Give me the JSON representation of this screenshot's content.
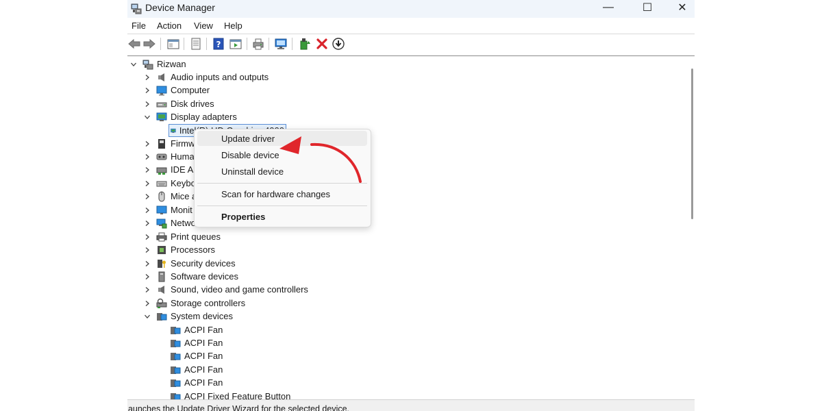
{
  "window": {
    "title": "Device Manager"
  },
  "window_controls": {
    "minimize": "—",
    "maximize": "☐",
    "close": "✕"
  },
  "menu": [
    "File",
    "Action",
    "View",
    "Help"
  ],
  "toolbar_icons": [
    "back-arrow-icon",
    "forward-arrow-icon",
    "show-hide-console-tree-icon",
    "properties-sheet-icon",
    "help-icon",
    "show-action-pane-icon",
    "print-icon",
    "scan-hardware-icon",
    "update-driver-icon",
    "disable-device-icon",
    "uninstall-device-icon",
    "download-driver-icon"
  ],
  "tree": {
    "root": "Rizwan",
    "categories": [
      {
        "label": "Audio inputs and outputs",
        "icon": "speaker-icon",
        "expanded": false
      },
      {
        "label": "Computer",
        "icon": "computer-icon",
        "expanded": false
      },
      {
        "label": "Disk drives",
        "icon": "disk-drive-icon",
        "expanded": false
      },
      {
        "label": "Display adapters",
        "icon": "display-adapter-icon",
        "expanded": true
      },
      {
        "label": "Firmw",
        "icon": "firmware-icon",
        "expanded": false
      },
      {
        "label": "Huma",
        "icon": "hid-icon",
        "expanded": false
      },
      {
        "label": "IDE A",
        "icon": "ide-controller-icon",
        "expanded": false
      },
      {
        "label": "Keybo",
        "icon": "keyboard-icon",
        "expanded": false
      },
      {
        "label": "Mice a",
        "icon": "mouse-icon",
        "expanded": false
      },
      {
        "label": "Monit",
        "icon": "monitor-icon",
        "expanded": false
      },
      {
        "label": "Netwo",
        "icon": "network-adapter-icon",
        "expanded": false
      },
      {
        "label": "Print queues",
        "icon": "printer-icon",
        "expanded": false
      },
      {
        "label": "Processors",
        "icon": "processor-icon",
        "expanded": false
      },
      {
        "label": "Security devices",
        "icon": "security-key-icon",
        "expanded": false
      },
      {
        "label": "Software devices",
        "icon": "software-device-icon",
        "expanded": false
      },
      {
        "label": "Sound, video and game controllers",
        "icon": "speaker-icon",
        "expanded": false
      },
      {
        "label": "Storage controllers",
        "icon": "storage-controller-icon",
        "expanded": false
      },
      {
        "label": "System devices",
        "icon": "system-device-icon",
        "expanded": true
      }
    ],
    "display_adapter_child": "Intel(R) HD Graphics 4000",
    "system_children": [
      "ACPI Fan",
      "ACPI Fan",
      "ACPI Fan",
      "ACPI Fan",
      "ACPI Fan",
      "ACPI Fixed Feature Button"
    ]
  },
  "context_menu": {
    "update_driver": "Update driver",
    "disable_device": "Disable device",
    "uninstall_device": "Uninstall device",
    "scan_hardware": "Scan for hardware changes",
    "properties": "Properties"
  },
  "status": "Launches the Update Driver Wizard for the selected device.",
  "colors": {
    "accent": "#5a8fd6",
    "arrow": "#e0262b",
    "titlebar": "#f0f5fb"
  }
}
